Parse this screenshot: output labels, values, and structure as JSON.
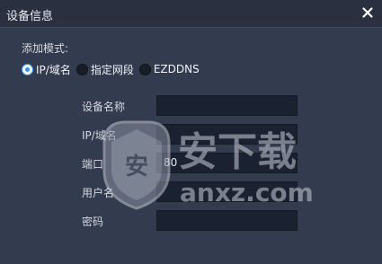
{
  "dialog": {
    "title": "设备信息",
    "close_icon": "close-icon"
  },
  "mode": {
    "label": "添加模式:",
    "options": [
      {
        "label": "IP/域名",
        "selected": true
      },
      {
        "label": "指定网段",
        "selected": false
      },
      {
        "label": "EZDDNS",
        "selected": false
      }
    ]
  },
  "fields": {
    "device_name": {
      "label": "设备名称",
      "value": ""
    },
    "ip_domain": {
      "label": "IP/域名",
      "value": ""
    },
    "port": {
      "label": "端口",
      "value": "80"
    },
    "username": {
      "label": "用户名",
      "value": ""
    },
    "password": {
      "label": "密码",
      "value": ""
    }
  },
  "watermark": {
    "text": "安下载",
    "domain": "anxz.com",
    "shield_char": "安"
  },
  "colors": {
    "accent": "#3b8ff0",
    "background": "#333b4f",
    "field_bg": "#1a2131"
  }
}
